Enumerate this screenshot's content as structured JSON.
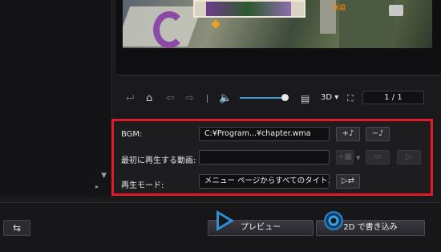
{
  "left_panel": {
    "scroll_down_glyph": "▼",
    "scroll_right_glyph": "▸"
  },
  "preview": {
    "stamp_text": "水辺"
  },
  "controls": {
    "mode_3d": "3D ▾",
    "page_indicator": "1 / 1",
    "volume_level_fraction": 0.85,
    "accent_color": "#3b9bd9"
  },
  "settings": {
    "bgm_label": "BGM:",
    "bgm_value": "C:¥Program...¥chapter.wma",
    "first_video_label": "最初に再生する動画:",
    "first_video_value": "",
    "play_mode_label": "再生モード:",
    "play_mode_value": "メニュー ページからすべてのタイトルを順番に",
    "highlight_color": "#e11b2a"
  },
  "bottom": {
    "preview_button": "プレビュー",
    "burn_button": "2D で書き込み"
  }
}
